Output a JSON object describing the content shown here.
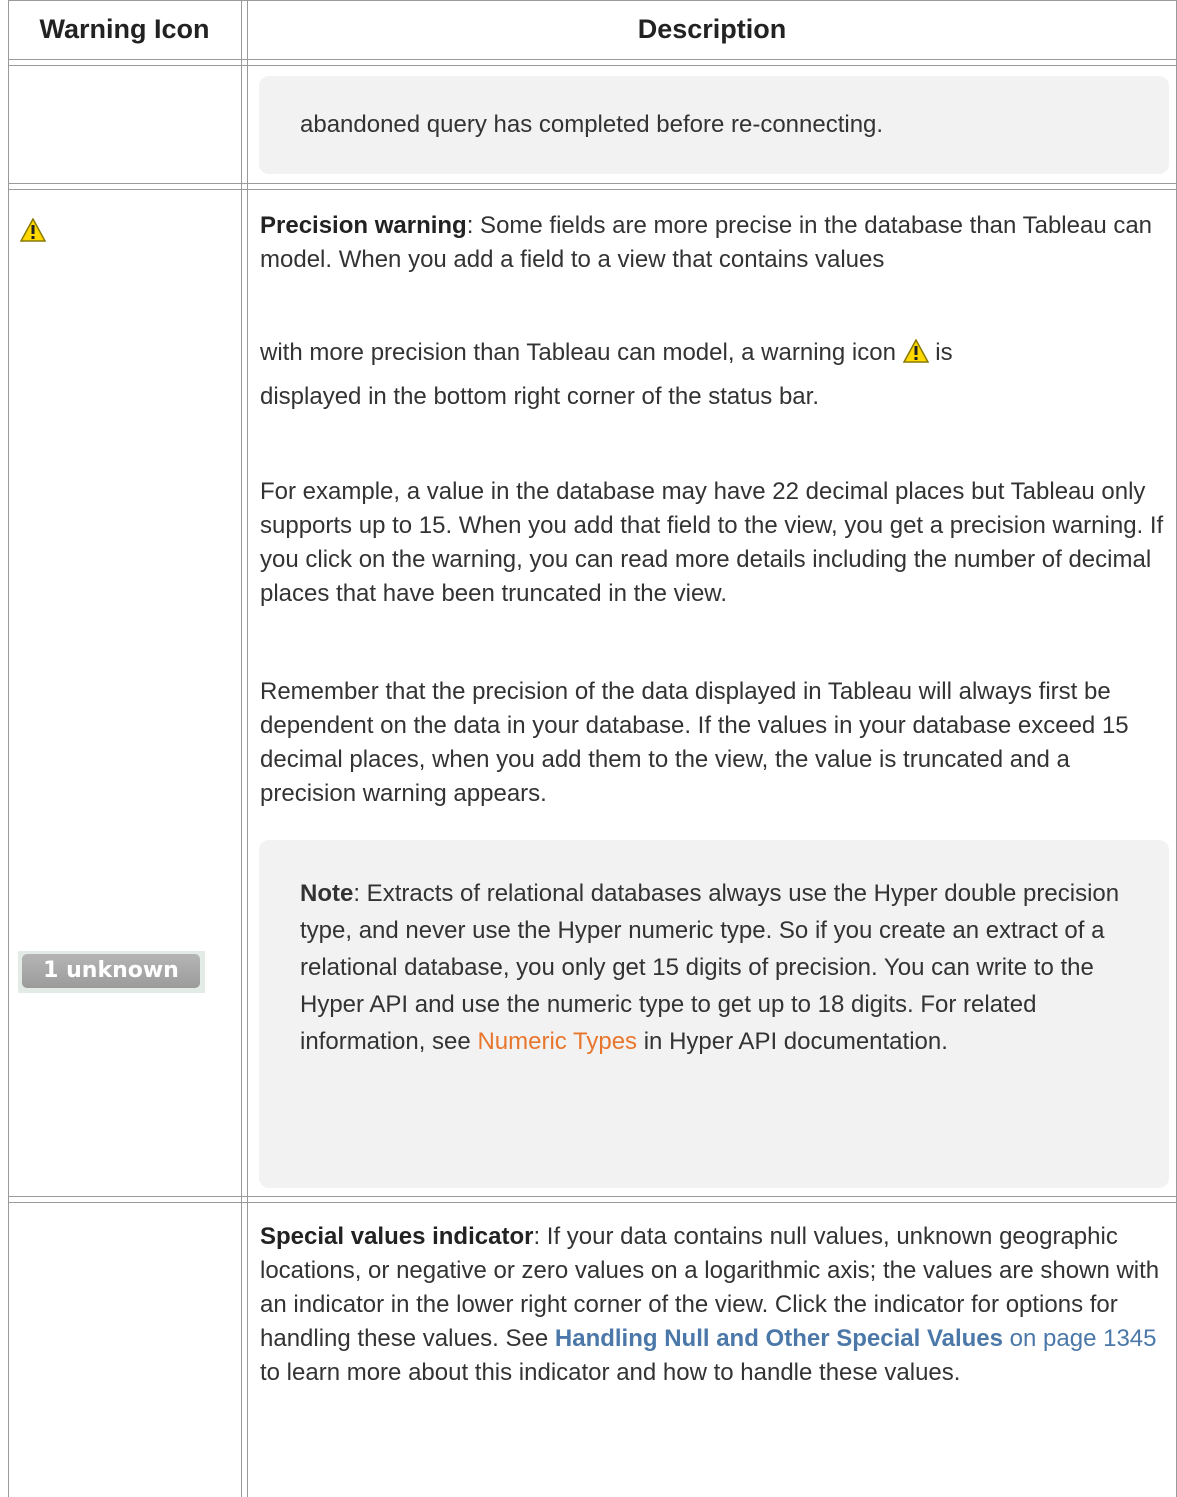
{
  "table": {
    "headers": {
      "warning_icon": "Warning Icon",
      "description": "Description"
    }
  },
  "row_continued": {
    "callout_text": "abandoned query has completed before re-connecting."
  },
  "row_precision": {
    "icon": "warning-triangle-icon",
    "title": "Precision warning",
    "intro_1": ": Some fields are more precise in the database than Tableau can model. When you add a field to a view that contains values",
    "intro_2a": "with more precision than Tableau can model, a warning icon",
    "intro_2b": "is",
    "intro_3": "displayed in the bottom right corner of the status bar.",
    "example": "For example, a value in the database may have 22 decimal places but Tableau only supports up to 15. When you add that field to the view, you get a precision warning. If you click on the warning, you can read more details including the number of decimal places that have been truncated in the view.",
    "remember": "Remember that the precision of the data displayed in Tableau will always first be dependent on the data in your database. If the values in your database exceed 15 decimal places, when you add them to the view, the value is truncated and a precision warning appears.",
    "note_label": "Note",
    "note_text": ": Extracts of relational databases always use the Hyper double precision type, and never use the Hyper numeric type. So if you create an extract of a relational database, you only get 15 digits of precision. You can write to the Hyper API and use the numeric type to get up to 18 digits. For related information, see",
    "note_link": "Numeric Types",
    "note_suffix": "in Hyper API documentation."
  },
  "row_special": {
    "badge_text": "1 unknown",
    "title": "Special values indicator",
    "text_1": ": If your data contains null values, unknown geographic locations, or negative or zero values on a logarithmic axis; the values are shown with an indicator in the lower right corner of the view. Click the indicator for options for handling these values. See",
    "link_text": "Handling Null and Other Special Values",
    "page_ref": "on page 1345",
    "text_2": "to learn more about this indicator and how to handle these values."
  },
  "colors": {
    "link_orange": "#e8762d",
    "link_blue": "#4b78a8",
    "callout_bg": "#f2f2f2",
    "border": "#9a9a9a"
  }
}
